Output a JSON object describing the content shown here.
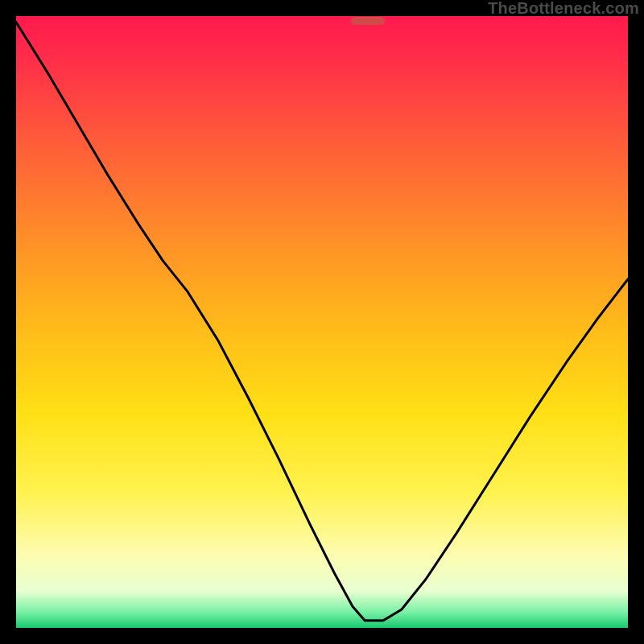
{
  "watermark": "TheBottleneck.com",
  "frame": {
    "outer": 800,
    "border": 20
  },
  "marker": {
    "x_pct": 57.5,
    "y_pct": 99.2,
    "width_pct": 5.6,
    "height_pct": 1.4,
    "color": "#d04a4a"
  },
  "chart_data": {
    "type": "line",
    "title": "",
    "xlabel": "",
    "ylabel": "",
    "xlim": [
      0,
      100
    ],
    "ylim": [
      0,
      100
    ],
    "grid": false,
    "legend": false,
    "background": "rainbow-vertical-gradient",
    "series": [
      {
        "name": "left-branch",
        "x": [
          0.0,
          5.0,
          10.0,
          15.0,
          20.0,
          24.0,
          28.0,
          33.0,
          38.0,
          43.0,
          48.0,
          52.0,
          55.0,
          57.0,
          60.0
        ],
        "y": [
          99.0,
          91.0,
          82.5,
          74.0,
          66.0,
          60.0,
          55.0,
          47.0,
          37.5,
          27.5,
          17.0,
          9.0,
          3.5,
          1.2,
          1.2
        ]
      },
      {
        "name": "right-branch",
        "x": [
          60.0,
          63.0,
          67.0,
          72.0,
          78.0,
          84.0,
          90.0,
          95.0,
          100.0
        ],
        "y": [
          1.2,
          3.0,
          8.0,
          15.5,
          25.0,
          34.5,
          43.5,
          50.5,
          57.0
        ]
      }
    ],
    "annotations": []
  }
}
